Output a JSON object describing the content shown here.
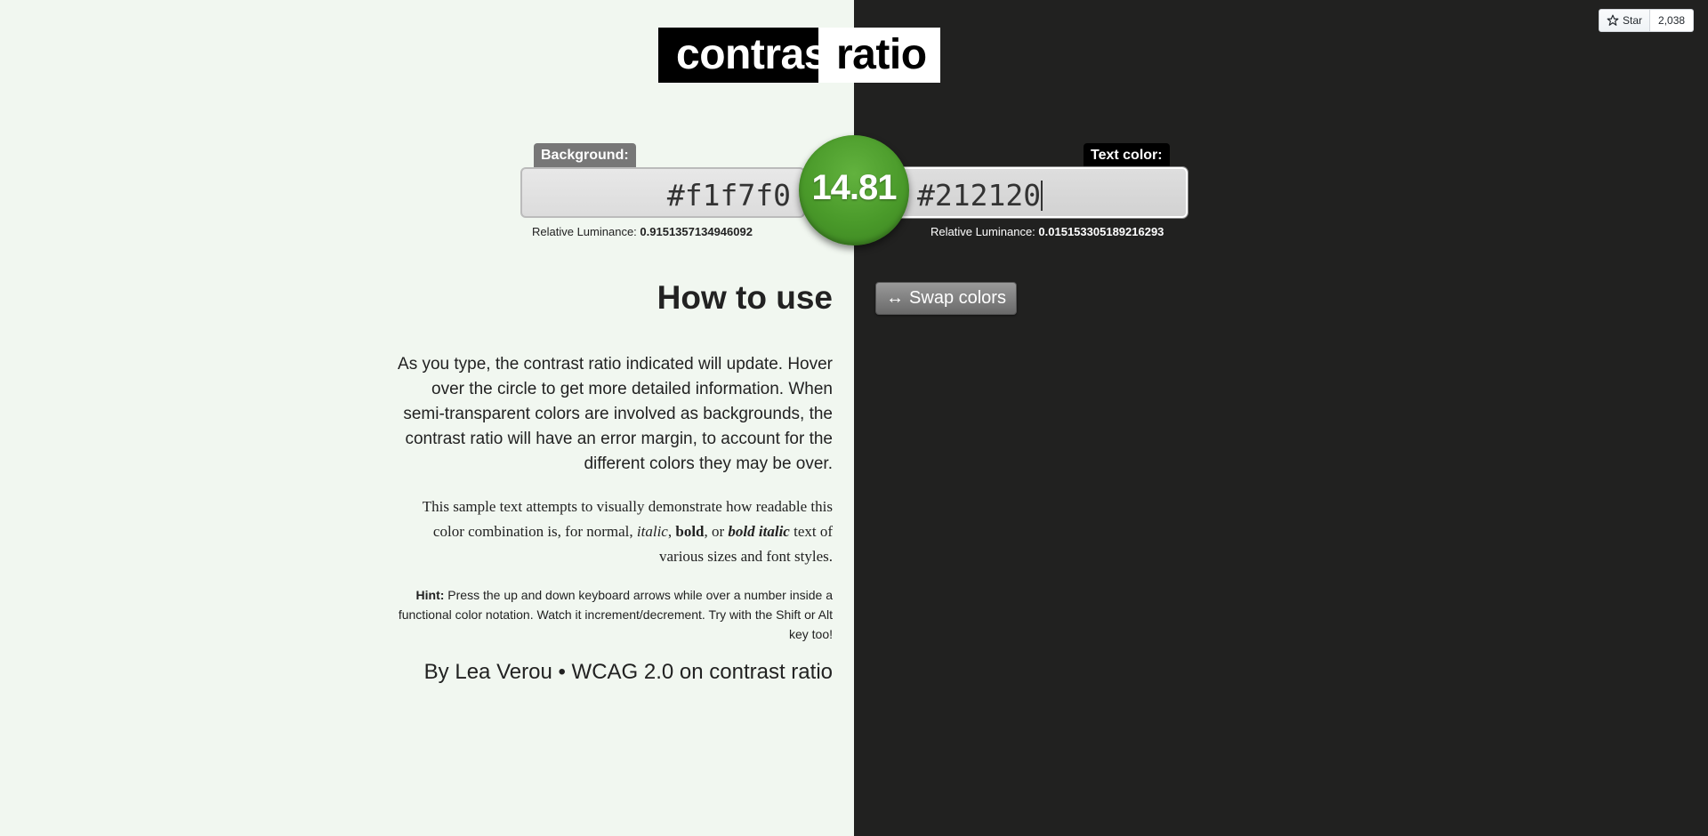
{
  "logo": {
    "part1": "contrast",
    "part2": "ratio"
  },
  "github": {
    "star_label": "Star",
    "count": "2,038"
  },
  "background": {
    "label": "Background:",
    "value": "#f1f7f0",
    "luminance_label": "Relative Luminance:",
    "luminance_value": "0.9151357134946092"
  },
  "text_color": {
    "label": "Text color:",
    "value": "#212120",
    "luminance_label": "Relative Luminance:",
    "luminance_value": "0.015153305189216293"
  },
  "ratio": "14.81",
  "swap_button": {
    "icon": "↔",
    "label": "Swap colors"
  },
  "how_to_use": {
    "title": "How to use",
    "paragraph": "As you type, the contrast ratio indicated will update. Hover over the circle to get more detailed information. When semi-transparent colors are involved as backgrounds, the contrast ratio will have an error margin, to account for the different colors they may be over.",
    "sample_1": "This sample text attempts to visually demonstrate how readable this color combination is, for normal, ",
    "sample_italic": "italic",
    "sample_2": ", ",
    "sample_bold": "bold",
    "sample_3": ", or ",
    "sample_bold_italic": "bold italic",
    "sample_4": " text of various sizes and font styles.",
    "hint_label": "Hint:",
    "hint_text": " Press the up and down keyboard arrows while over a number inside a functional color notation. Watch it increment/decrement. Try with the Shift or Alt key too!",
    "by_prefix": "By ",
    "author": "Lea Verou",
    "separator": " • ",
    "wcag_link": "WCAG 2.0 on contrast ratio"
  },
  "colors": {
    "left_bg": "#f1f7f0",
    "right_bg": "#212120",
    "ratio_circle": "#4a9a2a"
  }
}
